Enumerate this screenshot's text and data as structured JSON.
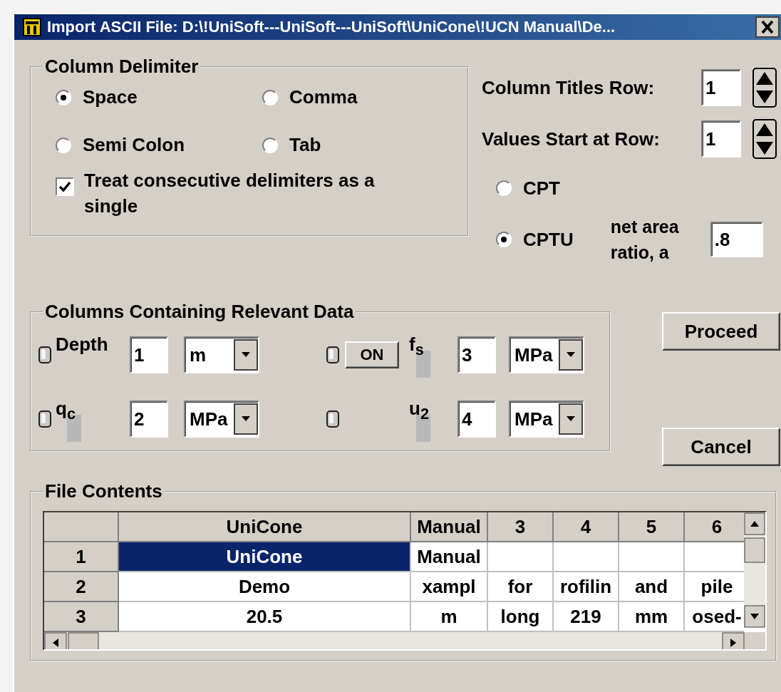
{
  "window": {
    "title": "Import ASCII File: D:\\!UniSoft---UniSoft---UniSoft\\UniCone\\!UCN Manual\\De..."
  },
  "column_delimiter": {
    "title": "Column Delimiter",
    "options": [
      {
        "label": "Space",
        "selected": true
      },
      {
        "label": "Comma",
        "selected": false
      },
      {
        "label": "Semi Colon",
        "selected": false
      },
      {
        "label": "Tab",
        "selected": false
      }
    ],
    "consecutive": {
      "label": "Treat consecutive delimiters as a single",
      "checked": true
    }
  },
  "column_titles_row": {
    "label": "Column Titles Row:",
    "value": "1"
  },
  "values_start_row": {
    "label": "Values Start at Row:",
    "value": "1"
  },
  "test_type": [
    {
      "label": "CPT",
      "selected": false
    },
    {
      "label": "CPTU",
      "selected": true
    }
  ],
  "net_area_ratio": {
    "label": "net area ratio, a",
    "value": ".8"
  },
  "relevant_data": {
    "title": "Columns Containing Relevant Data",
    "rows": [
      {
        "left": {
          "label": "Depth",
          "column": "1",
          "unit": "m"
        },
        "right": {
          "label": "f$_{s}$",
          "column": "3",
          "unit": "MPa",
          "button": "ON"
        }
      },
      {
        "left": {
          "label": "q$_{c}$",
          "column": "2",
          "unit": "MPa"
        },
        "right": {
          "label": "u$_{2}$",
          "column": "4",
          "unit": "MPa"
        }
      }
    ]
  },
  "buttons": [
    {
      "label": "Proceed"
    },
    {
      "label": "Cancel"
    }
  ],
  "file_contents": {
    "title": "File Contents",
    "columns": [
      "UniCone",
      "Manual",
      "3",
      "4",
      "5",
      "6"
    ],
    "rows": [
      {
        "header": "1",
        "cells": [
          {
            "text": "UniCone",
            "selected": true
          },
          {
            "text": "Manual",
            "selected": false
          }
        ]
      },
      {
        "header": "2",
        "cells": [
          {
            "text": "Demo",
            "selected": false
          },
          {
            "text": "xampl",
            "selected": false
          },
          {
            "text": "for",
            "selected": false
          },
          {
            "text": "rofilin",
            "selected": false
          },
          {
            "text": "and",
            "selected": false
          },
          {
            "text": "pile",
            "selected": false
          }
        ]
      },
      {
        "header": "3",
        "cells": [
          {
            "text": "20.5",
            "selected": false
          },
          {
            "text": "m",
            "selected": false
          },
          {
            "text": "long",
            "selected": false
          },
          {
            "text": "219",
            "selected": false
          },
          {
            "text": "mm",
            "selected": false
          },
          {
            "text": "osed-",
            "selected": false
          }
        ]
      }
    ]
  }
}
